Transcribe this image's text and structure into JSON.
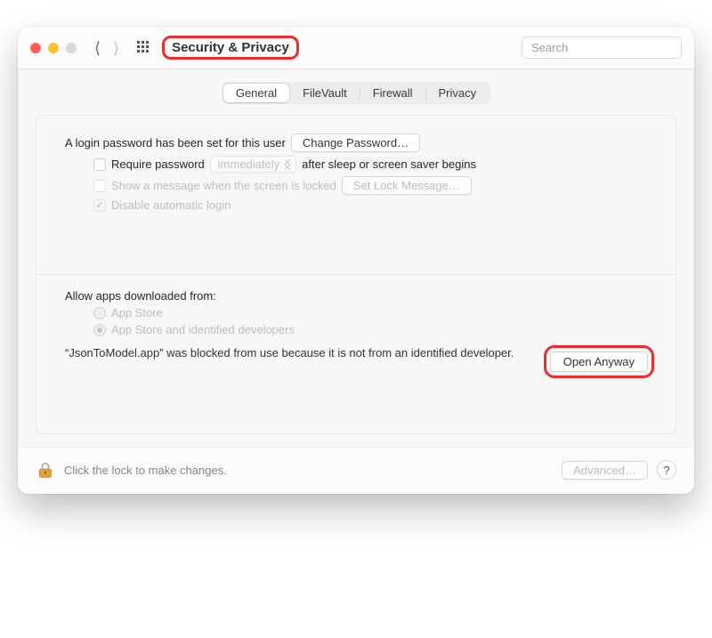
{
  "titlebar": {
    "title": "Security & Privacy",
    "search_placeholder": "Search"
  },
  "tabs": [
    "General",
    "FileVault",
    "Firewall",
    "Privacy"
  ],
  "active_tab": 0,
  "general": {
    "password_set_label": "A login password has been set for this user",
    "change_password_btn": "Change Password…",
    "require_pw_label": "Require password",
    "require_pw_select": "immediately",
    "require_pw_after": "after sleep or screen saver begins",
    "show_msg_label": "Show a message when the screen is locked",
    "set_lock_msg_btn": "Set Lock Message…",
    "disable_auto_login": "Disable automatic login"
  },
  "allow": {
    "heading": "Allow apps downloaded from:",
    "opt_appstore": "App Store",
    "opt_identified": "App Store and identified developers",
    "blocked_msg": "“JsonToModel.app” was blocked from use because it is not from an identified developer.",
    "open_anyway_btn": "Open Anyway"
  },
  "footer": {
    "lock_text": "Click the lock to make changes.",
    "advanced_btn": "Advanced…",
    "help": "?"
  }
}
